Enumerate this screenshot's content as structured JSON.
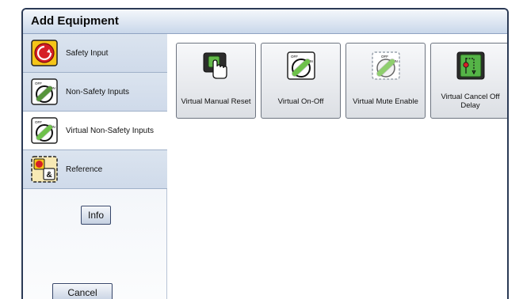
{
  "window": {
    "title": "Add Equipment"
  },
  "sidebar": {
    "items": [
      {
        "label": "Safety Input",
        "icon": "emergency-stop-icon",
        "selected": false
      },
      {
        "label": "Non-Safety Inputs",
        "icon": "off-on-switch-icon",
        "selected": false
      },
      {
        "label": "Virtual Non-Safety Inputs",
        "icon": "virtual-off-on-switch-icon",
        "selected": true
      },
      {
        "label": "Reference",
        "icon": "reference-icon",
        "selected": false
      }
    ],
    "info_label": "Info",
    "cancel_label": "Cancel"
  },
  "tiles": [
    {
      "label": "Virtual Manual Reset",
      "icon": "hand-press-button-icon"
    },
    {
      "label": "Virtual On-Off",
      "icon": "off-on-switch-icon"
    },
    {
      "label": "Virtual Mute Enable",
      "icon": "mute-enable-switch-icon"
    },
    {
      "label": "Virtual Cancel Off Delay",
      "icon": "cancel-off-delay-icon"
    }
  ],
  "icon_text": {
    "off": "OFF",
    "on": "ON",
    "amp": "&"
  },
  "colors": {
    "border_dark": "#2b3a55",
    "sidebar_bg": "#d6e0ed",
    "estop_yellow": "#f5c518",
    "estop_red": "#d61f26",
    "switch_green": "#6ec14a",
    "delay_green": "#55b447"
  }
}
